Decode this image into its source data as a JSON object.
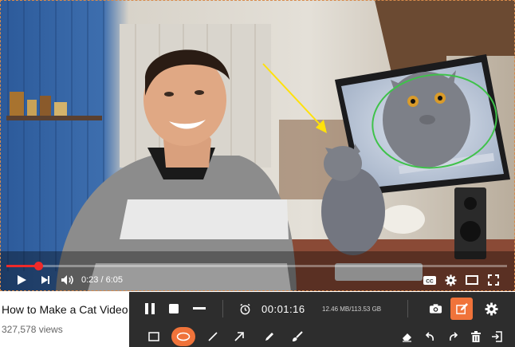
{
  "player": {
    "current_time": "0:23",
    "duration": "6:05",
    "time_display": "0:23 / 6:05",
    "progress_fraction": 0.063,
    "accent_color": "#ee2a2a"
  },
  "video": {
    "title": "How to Make a Cat Video",
    "views": "327,578 views"
  },
  "recorder": {
    "timer": "00:01:16",
    "file_size": "12.46 MB/113.53 GB",
    "accent_color": "#f0733a",
    "top_tools": [
      "pause-icon",
      "stop-icon",
      "minimize-icon",
      "alarm-clock-icon",
      "camera-icon",
      "edit-icon",
      "gear-icon"
    ],
    "draw_tools": [
      "rectangle-icon",
      "ellipse-icon",
      "line-icon",
      "arrow-icon",
      "pen-icon",
      "brush-icon",
      "eraser-icon",
      "undo-icon",
      "redo-icon",
      "trash-icon",
      "exit-icon"
    ],
    "active_draw_tool": "ellipse-icon",
    "active_top_tool": "edit-icon"
  }
}
